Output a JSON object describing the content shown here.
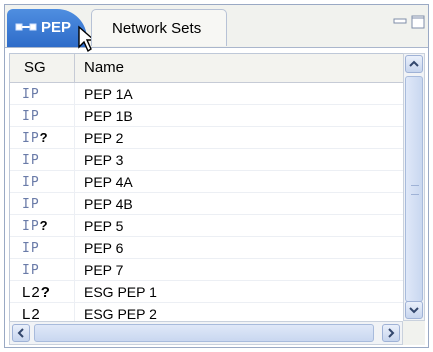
{
  "tabs": {
    "active_label": "PEP",
    "inactive_label": "Network Sets"
  },
  "table": {
    "headers": {
      "sg": "SG",
      "name": "Name"
    },
    "rows": [
      {
        "sg": "IP",
        "flag": "",
        "name": "PEP 1A"
      },
      {
        "sg": "IP",
        "flag": "",
        "name": "PEP 1B"
      },
      {
        "sg": "IP",
        "flag": "?",
        "name": "PEP 2"
      },
      {
        "sg": "IP",
        "flag": "",
        "name": "PEP 3"
      },
      {
        "sg": "IP",
        "flag": "",
        "name": "PEP 4A"
      },
      {
        "sg": "IP",
        "flag": "",
        "name": "PEP 4B"
      },
      {
        "sg": "IP",
        "flag": "?",
        "name": "PEP 5"
      },
      {
        "sg": "IP",
        "flag": "",
        "name": "PEP 6"
      },
      {
        "sg": "IP",
        "flag": "",
        "name": "PEP 7"
      },
      {
        "sg": "L2",
        "flag": "?",
        "name": "ESG PEP 1"
      },
      {
        "sg": "L2",
        "flag": "",
        "name": "ESG PEP 2"
      }
    ]
  },
  "icons": {
    "tab_icon": "network-node-icon",
    "minimize": "minimize-icon",
    "maximize": "maximize-icon",
    "cursor": "mouse-pointer-icon"
  }
}
